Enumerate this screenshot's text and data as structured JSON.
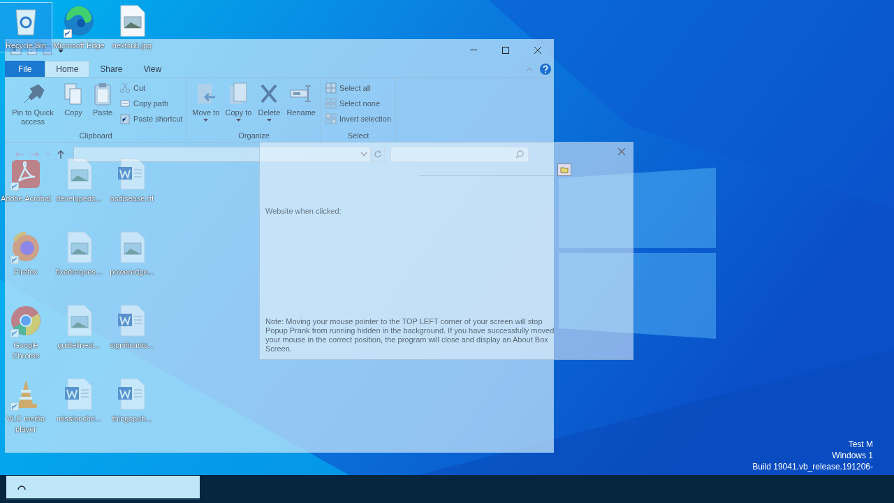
{
  "desktop_columns": [
    {
      "icons": [
        {
          "label": "Recycle Bin",
          "kind": "recycle",
          "shortcut": false,
          "selected": true
        },
        {
          "label": "Adobe Acrobat",
          "kind": "acrobat",
          "shortcut": true,
          "selected": false
        },
        {
          "label": "Firefox",
          "kind": "firefox",
          "shortcut": true,
          "selected": false
        },
        {
          "label": "Google Chrome",
          "kind": "chrome",
          "shortcut": true,
          "selected": false
        },
        {
          "label": "VLC media player",
          "kind": "vlc",
          "shortcut": true,
          "selected": false
        }
      ]
    },
    {
      "icons": [
        {
          "label": "Microsoft Edge",
          "kind": "edge",
          "shortcut": true,
          "selected": false
        },
        {
          "label": "developeds...",
          "shortcut": false,
          "selected": false
        },
        {
          "label": "fixedreques...",
          "shortcut": false,
          "selected": false
        },
        {
          "label": "guidelinesi...",
          "shortcut": false,
          "selected": false
        },
        {
          "label": "missionchri...",
          "kind": "word",
          "shortcut": false,
          "selected": false
        }
      ]
    },
    {
      "icons": [
        {
          "label": "nextsub.jpg",
          "shortcut": false,
          "selected": false
        },
        {
          "label": "osdisease.rtf",
          "kind": "word",
          "shortcut": false,
          "selected": false
        },
        {
          "label": "poweredgo...",
          "shortcut": false,
          "selected": false
        },
        {
          "label": "significants...",
          "kind": "word",
          "shortcut": false,
          "selected": false
        },
        {
          "label": "thingspub...",
          "kind": "word",
          "shortcut": false,
          "selected": false
        }
      ]
    }
  ],
  "explorer": {
    "tabs": [
      {
        "label": "File",
        "kind": "file",
        "selected": false
      },
      {
        "label": "Home",
        "kind": "tab",
        "selected": true
      },
      {
        "label": "Share",
        "kind": "tab",
        "selected": false
      },
      {
        "label": "View",
        "kind": "tab",
        "selected": false
      }
    ],
    "ribbon_groups": [
      {
        "label": "Clipboard",
        "large": [
          {
            "label": "Pin to Quick access",
            "kind": "pin",
            "dropdown": false
          },
          {
            "label": "Copy",
            "kind": "copy",
            "dropdown": false
          },
          {
            "label": "Paste",
            "kind": "paste",
            "dropdown": false
          }
        ],
        "small": [
          {
            "label": "Cut",
            "kind": "cut"
          },
          {
            "label": "Copy path",
            "kind": "copypath"
          },
          {
            "label": "Paste shortcut",
            "kind": "pasteshortcut"
          }
        ]
      },
      {
        "label": "Organize",
        "large": [
          {
            "label": "Move to",
            "kind": "move",
            "dropdown": true
          },
          {
            "label": "Copy to",
            "kind": "copyto",
            "dropdown": true
          },
          {
            "label": "Delete",
            "kind": "delete",
            "dropdown": true
          },
          {
            "label": "Rename",
            "kind": "rename",
            "dropdown": false
          }
        ]
      },
      {
        "label": "Select",
        "small": [
          {
            "label": "Select all",
            "kind": "selectall"
          },
          {
            "label": "Select none",
            "kind": "selectnone"
          },
          {
            "label": "Invert selection",
            "kind": "invert"
          }
        ]
      }
    ]
  },
  "popup": {
    "field_label": "Website when clicked:",
    "note": "Note: Moving your mouse pointer to the TOP LEFT corner of your screen will stop Popup Prank from running hidden in the background. If you have successfully moved your mouse in the correct position, the program will close and display an About Box Screen."
  },
  "build_info": [
    "Test M",
    "Windows 1",
    "Build 19041.vb_release.191206-"
  ]
}
